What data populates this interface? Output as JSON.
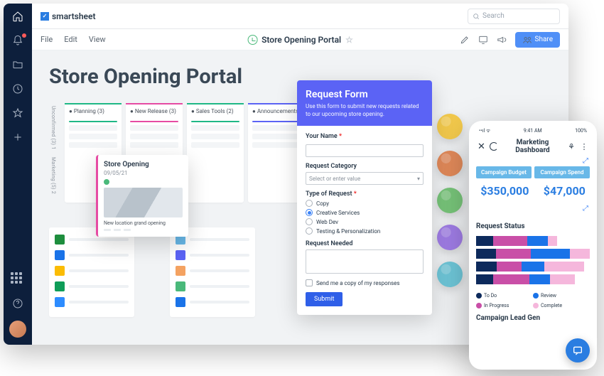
{
  "brand": "smartsheet",
  "search_placeholder": "Search",
  "menu": {
    "file": "File",
    "edit": "Edit",
    "view": "View"
  },
  "doc_title": "Store Opening Portal",
  "share_label": "Share",
  "page_title": "Store Opening Portal",
  "side_tabs": [
    "Unconfirmed (3) 1",
    "Marketing (5) 2"
  ],
  "lanes": [
    {
      "label": "Planning (3)",
      "color": "#1fb886"
    },
    {
      "label": "New Release (3)",
      "color": "#e64ba3"
    },
    {
      "label": "Sales Tools (2)",
      "color": "#1fb886"
    },
    {
      "label": "Announcements",
      "color": "#5b63f5"
    }
  ],
  "card": {
    "title": "Store Opening",
    "date": "09/05/21",
    "desc": "New location grand opening"
  },
  "icon_colors": [
    [
      "#1e8e3e",
      "#1a73e8",
      "#fbbc04",
      "#0f9d58",
      "#2d8cff"
    ],
    [
      "#68b8e8",
      "#5b63f5",
      "#f4a261",
      "#4ab97a",
      "#1a73e8"
    ]
  ],
  "form": {
    "title": "Request Form",
    "subtitle": "Use this form to submit new requests related to our upcoming store opening.",
    "name_label": "Your Name",
    "category_label": "Request Category",
    "category_placeholder": "Select or enter value",
    "type_label": "Type of Request",
    "types": [
      "Copy",
      "Creative Services",
      "Web Dev",
      "Testing & Personalization"
    ],
    "type_selected": 1,
    "needed_label": "Request Needed",
    "send_copy_label": "Send me a copy of my responses",
    "submit_label": "Submit"
  },
  "avatars": [
    "#f2c94c",
    "#e28a5a",
    "#78c57a",
    "#a07de6",
    "#6fc7d9"
  ],
  "phone": {
    "time": "9:41 AM",
    "battery": "100%",
    "title": "Marketing Dashboard",
    "pills": [
      "Campaign Budget",
      "Campaign Spend"
    ],
    "kpis": [
      "$350,000",
      "$47,000"
    ],
    "status_title": "Request Status",
    "legend": [
      {
        "label": "To Do",
        "color": "#0d2a5c"
      },
      {
        "label": "Review",
        "color": "#1a73e8"
      },
      {
        "label": "In Progress",
        "color": "#c94fa7"
      },
      {
        "label": "Complete",
        "color": "#f5b7dc"
      }
    ],
    "bars_title": "Campaign Lead Gen"
  },
  "chart_data": {
    "type": "bar",
    "orientation": "horizontal-stacked",
    "series": [
      "To Do",
      "In Progress",
      "Review",
      "Complete"
    ],
    "colors": [
      "#0d2a5c",
      "#c94fa7",
      "#1a73e8",
      "#f5b7dc"
    ],
    "rows": [
      [
        15,
        30,
        18,
        8
      ],
      [
        20,
        35,
        40,
        20
      ],
      [
        18,
        22,
        20,
        35
      ],
      [
        15,
        32,
        18,
        22
      ]
    ]
  }
}
